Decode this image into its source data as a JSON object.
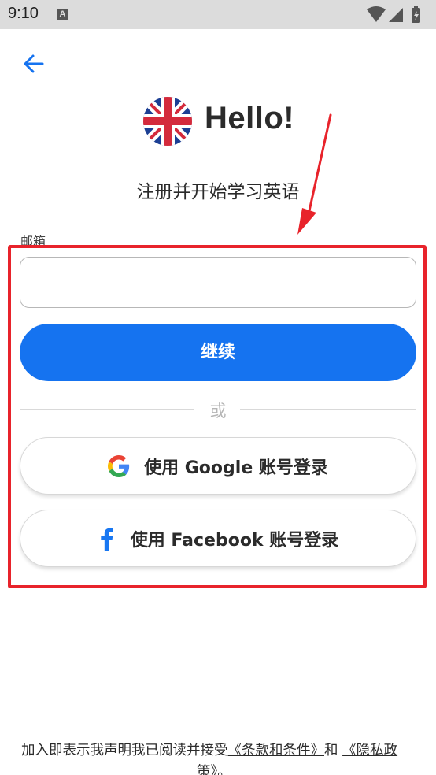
{
  "status_bar": {
    "time": "9:10",
    "notification_icon": "A"
  },
  "header": {
    "back_icon": "arrow-left-icon",
    "flag_icon": "uk-flag-icon",
    "title": "Hello!"
  },
  "subtitle": "注册并开始学习英语",
  "form": {
    "email_label": "邮箱",
    "email_value": "",
    "email_placeholder": "",
    "continue_label": "继续",
    "divider_text": "或",
    "google_label": "使用 Google 账号登录",
    "facebook_label": "使用 Facebook 账号登录"
  },
  "footer": {
    "prefix": "加入即表示我声明我已阅读并接受",
    "terms_link": "《条款和条件》",
    "conjunction": "和",
    "privacy_link_part1": "《隐私政",
    "privacy_link_part2": "策》",
    "suffix": "。"
  },
  "colors": {
    "primary": "#1573f0",
    "highlight": "#e8232b",
    "status_bar": "#dcdcdc",
    "facebook": "#1877f2"
  }
}
